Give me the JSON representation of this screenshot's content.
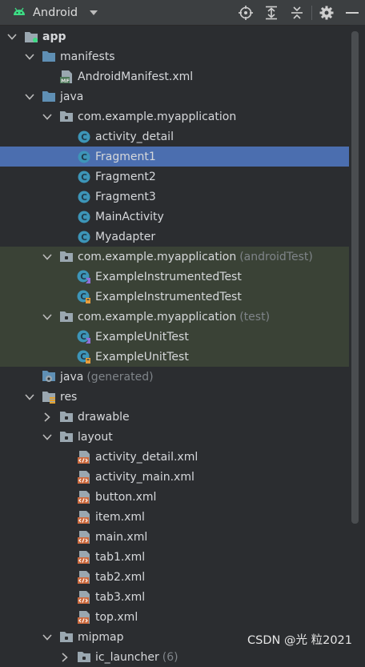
{
  "toolbar": {
    "view_label": "Android",
    "icons": [
      "android-icon",
      "chevron-down-icon",
      "locate-icon",
      "expand-all-icon",
      "collapse-all-icon",
      "gear-icon",
      "minimize-icon"
    ]
  },
  "tree": [
    {
      "name": "tree-item-app",
      "label": "app",
      "icon": "module",
      "depth": 0,
      "arrow": "down",
      "bold": true
    },
    {
      "name": "tree-item-manifests",
      "label": "manifests",
      "icon": "folder-blue",
      "depth": 1,
      "arrow": "down"
    },
    {
      "name": "tree-item-android-manifest",
      "label": "AndroidManifest.xml",
      "icon": "manifest",
      "depth": 2,
      "arrow": "none"
    },
    {
      "name": "tree-item-java",
      "label": "java",
      "icon": "folder-blue",
      "depth": 1,
      "arrow": "down"
    },
    {
      "name": "tree-item-package-main",
      "label": "com.example.myapplication",
      "icon": "package",
      "depth": 2,
      "arrow": "down"
    },
    {
      "name": "tree-item-activity-detail",
      "label": "activity_detail",
      "icon": "class",
      "depth": 3,
      "arrow": "none"
    },
    {
      "name": "tree-item-fragment1",
      "label": "Fragment1",
      "icon": "class",
      "depth": 3,
      "arrow": "none",
      "selected": true
    },
    {
      "name": "tree-item-fragment2",
      "label": "Fragment2",
      "icon": "class",
      "depth": 3,
      "arrow": "none"
    },
    {
      "name": "tree-item-fragment3",
      "label": "Fragment3",
      "icon": "class",
      "depth": 3,
      "arrow": "none"
    },
    {
      "name": "tree-item-main-activity",
      "label": "MainActivity",
      "icon": "class",
      "depth": 3,
      "arrow": "none"
    },
    {
      "name": "tree-item-myadapter",
      "label": "Myadapter",
      "icon": "class",
      "depth": 3,
      "arrow": "none"
    },
    {
      "name": "tree-item-package-android-test",
      "label": "com.example.myapplication",
      "suffix": "(androidTest)",
      "icon": "package",
      "depth": 2,
      "arrow": "down",
      "test": true
    },
    {
      "name": "tree-item-example-instrumented-test-1",
      "label": "ExampleInstrumentedTest",
      "icon": "test-class-k",
      "depth": 3,
      "arrow": "none",
      "test": true
    },
    {
      "name": "tree-item-example-instrumented-test-2",
      "label": "ExampleInstrumentedTest",
      "icon": "test-class-j",
      "depth": 3,
      "arrow": "none",
      "test": true
    },
    {
      "name": "tree-item-package-test",
      "label": "com.example.myapplication",
      "suffix": "(test)",
      "icon": "package",
      "depth": 2,
      "arrow": "down",
      "test": true
    },
    {
      "name": "tree-item-example-unit-test-1",
      "label": "ExampleUnitTest",
      "icon": "test-class-k",
      "depth": 3,
      "arrow": "none",
      "test": true
    },
    {
      "name": "tree-item-example-unit-test-2",
      "label": "ExampleUnitTest",
      "icon": "test-class-j",
      "depth": 3,
      "arrow": "none",
      "test": true
    },
    {
      "name": "tree-item-java-generated",
      "label": "java",
      "suffix": "(generated)",
      "icon": "folder-generated",
      "depth": 1,
      "arrow": "none"
    },
    {
      "name": "tree-item-res",
      "label": "res",
      "icon": "folder-res",
      "depth": 1,
      "arrow": "down"
    },
    {
      "name": "tree-item-drawable",
      "label": "drawable",
      "icon": "package",
      "depth": 2,
      "arrow": "right"
    },
    {
      "name": "tree-item-layout",
      "label": "layout",
      "icon": "package",
      "depth": 2,
      "arrow": "down"
    },
    {
      "name": "tree-item-activity-detail-xml",
      "label": "activity_detail.xml",
      "icon": "layout-xml",
      "depth": 3,
      "arrow": "none"
    },
    {
      "name": "tree-item-activity-main-xml",
      "label": "activity_main.xml",
      "icon": "layout-xml",
      "depth": 3,
      "arrow": "none"
    },
    {
      "name": "tree-item-button-xml",
      "label": "button.xml",
      "icon": "layout-xml",
      "depth": 3,
      "arrow": "none"
    },
    {
      "name": "tree-item-item-xml",
      "label": "item.xml",
      "icon": "layout-xml",
      "depth": 3,
      "arrow": "none"
    },
    {
      "name": "tree-item-main-xml",
      "label": "main.xml",
      "icon": "layout-xml",
      "depth": 3,
      "arrow": "none"
    },
    {
      "name": "tree-item-tab1-xml",
      "label": "tab1.xml",
      "icon": "layout-xml",
      "depth": 3,
      "arrow": "none"
    },
    {
      "name": "tree-item-tab2-xml",
      "label": "tab2.xml",
      "icon": "layout-xml",
      "depth": 3,
      "arrow": "none"
    },
    {
      "name": "tree-item-tab3-xml",
      "label": "tab3.xml",
      "icon": "layout-xml",
      "depth": 3,
      "arrow": "none"
    },
    {
      "name": "tree-item-top-xml",
      "label": "top.xml",
      "icon": "layout-xml",
      "depth": 3,
      "arrow": "none"
    },
    {
      "name": "tree-item-mipmap",
      "label": "mipmap",
      "icon": "package",
      "depth": 2,
      "arrow": "down"
    },
    {
      "name": "tree-item-ic-launcher",
      "label": "ic_launcher",
      "suffix": "(6)",
      "icon": "package",
      "depth": 3,
      "arrow": "right"
    }
  ],
  "watermark": "CSDN @光  粒2021",
  "colors": {
    "background": "#2b2d30",
    "selection": "#4b6eaf",
    "test_tint": "#3a4236",
    "class_icon": "#3d95b8",
    "folder_blue": "#5f8fb4",
    "android_green": "#3ddc84",
    "layout_xml": "#cd6b3f"
  }
}
